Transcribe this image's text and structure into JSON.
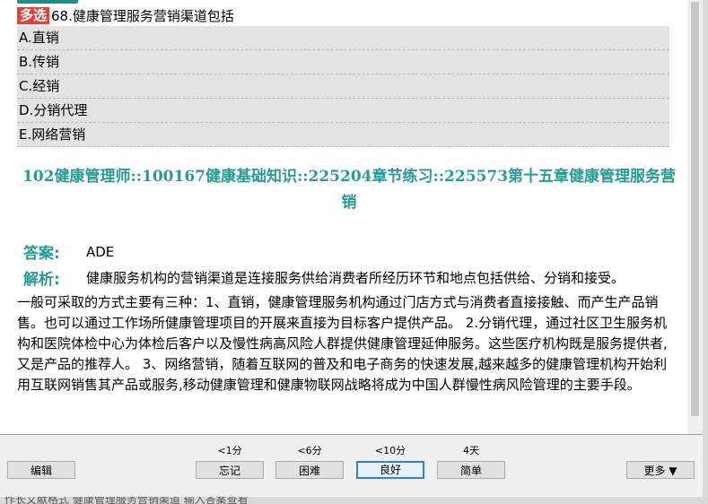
{
  "question": {
    "badge": "多选",
    "text": "68.健康管理服务营销渠道包括"
  },
  "options": [
    "A.直销",
    "B.传销",
    "C.经销",
    "D.分销代理",
    "E.网络营销"
  ],
  "path": "102健康管理师::100167健康基础知识::225204章节练习::225573第十五章健康管理服务营销",
  "answer": {
    "label": "答案:",
    "value": "ADE"
  },
  "explanation": {
    "label": "解析:",
    "first_line": "健康服务机构的营销渠道是连接服务供给消费者所经历环节和地点包括供给、分销和接受。",
    "body": "一般可采取的方式主要有三种：1、直销，健康管理服务机构通过门店方式与消费者直接接触、而产生产品销售。也可以通过工作场所健康管理项目的开展来直接为目标客户提供产品。 2.分销代理，通过社区卫生服务机构和医院体检中心为体检后客户以及慢性病高风险人群提供健康管理延伸服务。这些医疗机构既是服务提供者,又是产品的推荐人。 3、网络营销，随着互联网的普及和电子商务的快速发展,越来越多的健康管理机构开始利用互联网销售其产品或服务,移动健康管理和健康物联网战略将成为中国人群慢性病风险管理的主要手段。"
  },
  "toolbar": {
    "edit": "编辑",
    "more": "更多 ▼",
    "intervals": [
      "<1分",
      "<6分",
      "<10分",
      "4天"
    ],
    "buttons": [
      "忘记",
      "困难",
      "良好",
      "简单"
    ]
  },
  "background_strip": "作长文献格式  健康管理服务营销渠道  输入答案查看"
}
